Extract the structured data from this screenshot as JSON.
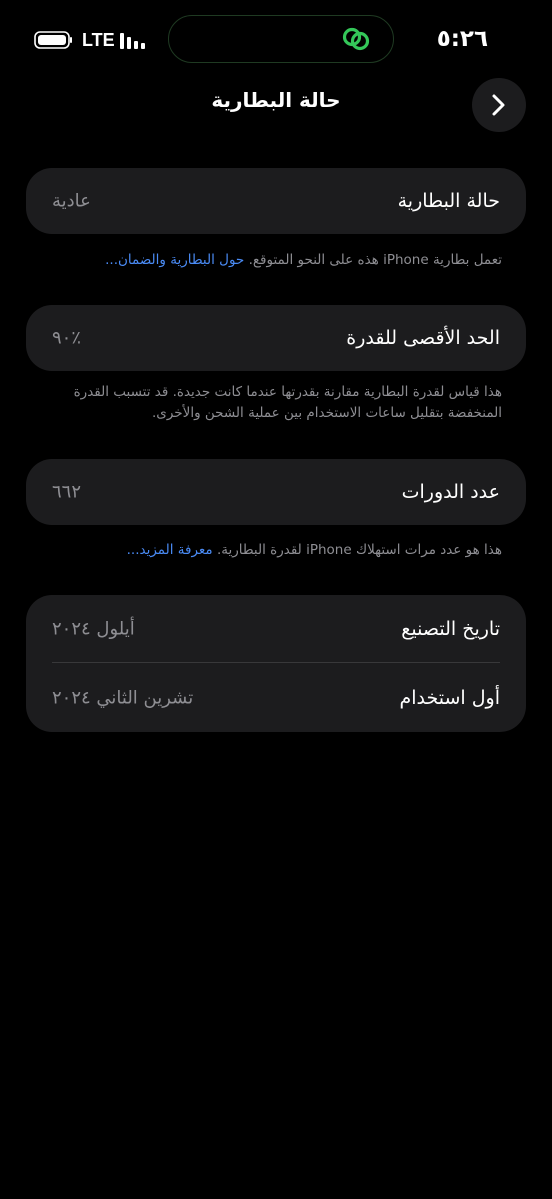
{
  "status_bar": {
    "time": "٥:٢٦",
    "network": "LTE",
    "battery_icon": "battery-full-icon",
    "signal_icon": "signal-bars-icon",
    "island_icon": "link-icon",
    "island_icon_color": "#34c759"
  },
  "nav": {
    "title": "حالة البطارية",
    "back_icon": "chevron-right-icon"
  },
  "battery_health": {
    "label": "حالة البطارية",
    "value": "عادية",
    "footnote_text": "تعمل بطارية iPhone هذه على النحو المتوقع.",
    "footnote_link": "حول البطارية والضمان..."
  },
  "maximum_capacity": {
    "label": "الحد الأقصى للقدرة",
    "value": "٪٩٠",
    "footnote_text": "هذا قياس لقدرة البطارية مقارنة بقدرتها عندما كانت جديدة. قد تتسبب القدرة المنخفضة بتقليل ساعات الاستخدام بين عملية الشحن والأخرى."
  },
  "cycle_count": {
    "label": "عدد الدورات",
    "value": "٦٦٢",
    "footnote_text": "هذا هو عدد مرات استهلاك iPhone لقدرة البطارية.",
    "footnote_link": "معرفة المزيد..."
  },
  "dates": {
    "manufacture_label": "تاريخ التصنيع",
    "manufacture_value": "أيلول ٢٠٢٤",
    "first_use_label": "أول استخدام",
    "first_use_value": "تشرين الثاني ٢٠٢٤"
  },
  "colors": {
    "background": "#000000",
    "card": "#1c1c1e",
    "link": "#4a8bf5",
    "secondary_text": "#8e8e93"
  }
}
